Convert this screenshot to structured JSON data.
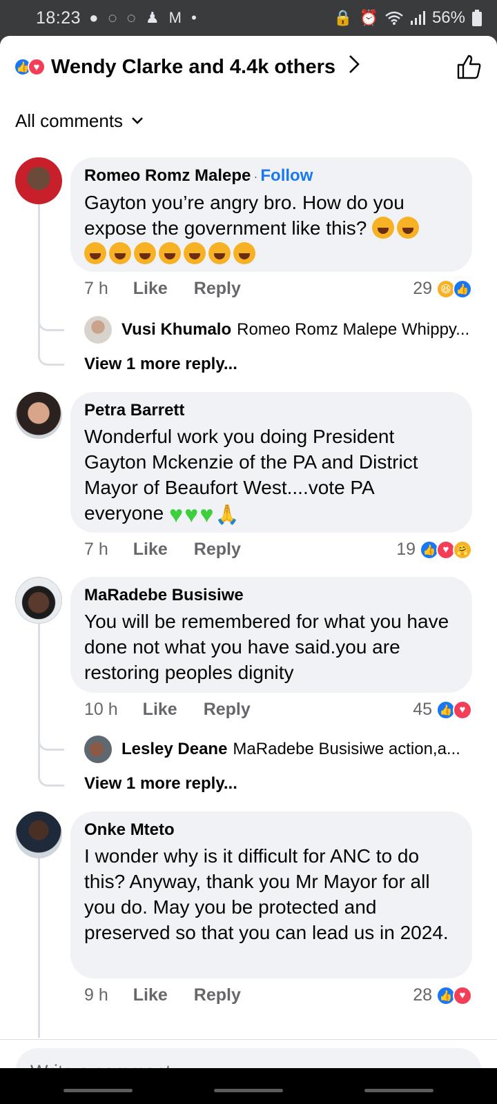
{
  "status_bar": {
    "time": "18:23",
    "notification_icons": "● ◌ ◌ ♟ M •",
    "battery": "56%"
  },
  "header": {
    "reactions_text": "Wendy Clarke and 4.4k others"
  },
  "sort": {
    "label": "All comments"
  },
  "comments": [
    {
      "author": "Romeo Romz Malepe",
      "follow": "Follow",
      "text": "Gayton you’re angry bro. How do you expose the government like this?",
      "time": "7 h",
      "like": "Like",
      "reply": "Reply",
      "reaction_count": "29",
      "reply_preview": {
        "author": "Vusi Khumalo",
        "text": "Romeo Romz Malepe Whippy..."
      },
      "view_more": "View 1 more reply..."
    },
    {
      "author": "Petra Barrett",
      "text": "Wonderful work you doing President Gayton Mckenzie of the  PA and District Mayor of Beaufort West....vote PA everyone",
      "time": "7 h",
      "like": "Like",
      "reply": "Reply",
      "reaction_count": "19"
    },
    {
      "author": "MaRadebe Busisiwe",
      "text": "You will be remembered for what you have done not what you have said.you are restoring peoples dignity",
      "time": "10 h",
      "like": "Like",
      "reply": "Reply",
      "reaction_count": "45",
      "reply_preview": {
        "author": "Lesley Deane",
        "text": "MaRadebe Busisiwe action,a..."
      },
      "view_more": "View 1 more reply..."
    },
    {
      "author": "Onke Mteto",
      "text": "I wonder why is it difficult for ANC to do this? Anyway, thank you Mr Mayor for all you do. May you be protected and preserved so that you can lead us in 2024.",
      "time": "9 h",
      "like": "Like",
      "reply": "Reply",
      "reaction_count": "28"
    }
  ],
  "composer": {
    "placeholder": "Write a comment..."
  },
  "colors": {
    "accent": "#1877f2",
    "love": "#f33e58",
    "bubble": "#f0f2f5"
  }
}
